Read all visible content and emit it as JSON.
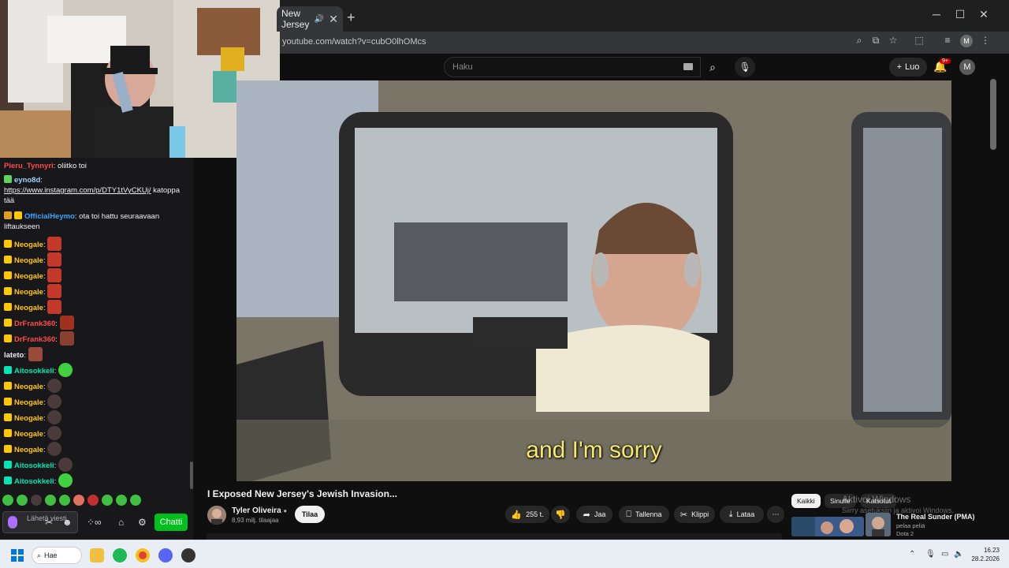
{
  "browser": {
    "tab_title": "New Jersey",
    "url": "youtube.com/watch?v=cubO0lhOMcs",
    "profile_initial": "M"
  },
  "youtube": {
    "search_placeholder": "Haku",
    "create_label": "Luo",
    "notification_count": "9+",
    "avatar_initial": "M",
    "subtitle": "and I'm sorry",
    "video_title": "I Exposed New Jersey's Jewish Invasion...",
    "channel_name": "Tyler Oliveira",
    "subscribers": "8,93 milj. tilaajaa",
    "subscribe_label": "Tilaa",
    "actions": {
      "likes": "255 t.",
      "share": "Jaa",
      "save": "Tallenna",
      "clip": "Klippi",
      "download": "Lataa",
      "more": "⋯"
    },
    "chips": [
      "Kaikki",
      "Sinulle",
      "Katsotut"
    ],
    "recommended": {
      "title": "The Real Sunder (PMA)",
      "channel": "pelaa peliä",
      "game": "Dota 2"
    }
  },
  "windows_activation": {
    "line1": "Aktivoi Windows",
    "line2": "Siirry asetuksiin ja aktivoi Windows."
  },
  "chat": {
    "messages": [
      {
        "user": "Pieru_Tynnyri",
        "color": "#ff4a4a",
        "text": "oliitko toi"
      },
      {
        "user": "eyno8d",
        "color": "#9cd3ff",
        "text": "https://www.instagram.com/p/DTY1tVyCKUj/ katoppa tää"
      },
      {
        "user": "OfficialHeymo",
        "color": "#3ea6ff",
        "text": "ota toi hattu seuraavaan liftaukseen"
      },
      {
        "user": "Neogale",
        "color": "#ffc800",
        "text": ""
      },
      {
        "user": "Neogale",
        "color": "#ffc800",
        "text": ""
      },
      {
        "user": "Neogale",
        "color": "#ffc800",
        "text": ""
      },
      {
        "user": "Neogale",
        "color": "#ffc800",
        "text": ""
      },
      {
        "user": "Neogale",
        "color": "#ffc800",
        "text": ""
      },
      {
        "user": "DrFrank360",
        "color": "#ff4a4a",
        "text": ""
      },
      {
        "user": "DrFrank360",
        "color": "#ff4a4a",
        "text": ""
      },
      {
        "user": "lateto",
        "color": "#efeff1",
        "text": ""
      },
      {
        "user": "Aitosokkeli",
        "color": "#00e5b4",
        "text": ""
      },
      {
        "user": "Neogale",
        "color": "#ffc800",
        "text": ""
      },
      {
        "user": "Neogale",
        "color": "#ffc800",
        "text": ""
      },
      {
        "user": "Neogale",
        "color": "#ffc800",
        "text": ""
      },
      {
        "user": "Neogale",
        "color": "#ffc800",
        "text": ""
      },
      {
        "user": "Neogale",
        "color": "#ffc800",
        "text": ""
      },
      {
        "user": "Aitosokkeli",
        "color": "#00e5b4",
        "text": ""
      },
      {
        "user": "Aitosokkeli",
        "color": "#00e5b4",
        "text": ""
      }
    ],
    "input_placeholder": "Lähetä viesti",
    "send_label": "Chatti"
  },
  "taskbar": {
    "search_label": "Hae",
    "time": "16.23",
    "date": "28.2.2026"
  },
  "colors": {
    "chat_bg": "#18181b",
    "yt_bg": "#0f0f0f",
    "chat_button": "#00c01b",
    "accent_purple": "#a970ff",
    "subtitle": "#f6e96c"
  }
}
